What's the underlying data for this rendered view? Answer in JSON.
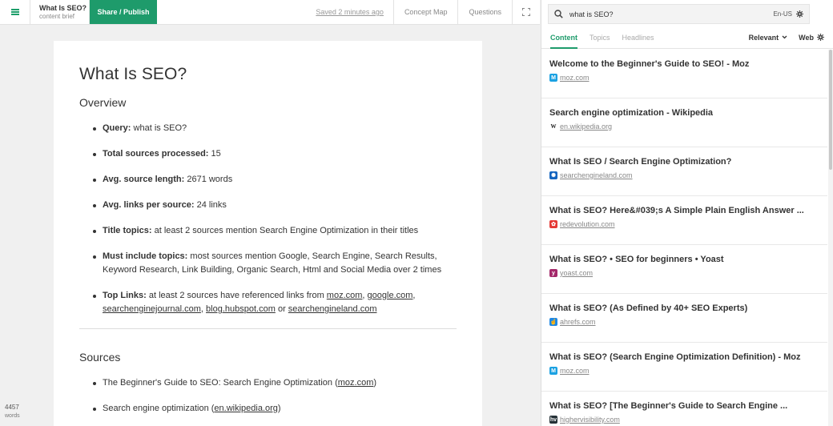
{
  "topbar": {
    "doc_title": "What Is SEO?",
    "doc_subtitle": "content brief",
    "share_label": "Share / Publish",
    "saved_label": "Saved 2 minutes ago",
    "nav": [
      "Concept Map",
      "Questions"
    ]
  },
  "doc": {
    "title": "What Is SEO?",
    "overview_heading": "Overview",
    "items": [
      {
        "label": "Query:",
        "text": " what is SEO?"
      },
      {
        "label": "Total sources processed:",
        "text": " 15"
      },
      {
        "label": "Avg. source length:",
        "text": " 2671 words"
      },
      {
        "label": "Avg. links per source:",
        "text": " 24 links"
      },
      {
        "label": "Title topics:",
        "text": " at least 2 sources mention Search Engine Optimization in their titles"
      },
      {
        "label": "Must include topics:",
        "text": " most sources mention Google, Search Engine, Search Results, Keyword Research, Link Building, Organic Search, Html and Social Media over 2 times"
      }
    ],
    "top_links": {
      "label": "Top Links:",
      "text": " at least 2 sources have referenced links from ",
      "links": [
        "moz.com",
        "google.com",
        "searchenginejournal.com",
        "blog.hubspot.com",
        "searchengineland.com"
      ],
      "or": " or "
    },
    "sources_heading": "Sources",
    "sources": [
      {
        "text": "The Beginner's Guide to SEO: Search Engine Optimization (",
        "link": "moz.com",
        "close": ")"
      },
      {
        "text": "Search engine optimization (",
        "link": "en.wikipedia.org",
        "close": ")"
      }
    ]
  },
  "wordcount": {
    "value": "4457",
    "label": "words"
  },
  "panel": {
    "search_value": "what is SEO?",
    "locale": "En-US",
    "tabs": [
      "Content",
      "Topics",
      "Headlines"
    ],
    "active_tab": "Content",
    "sort": "Relevant",
    "source": "Web",
    "results": [
      {
        "title": "Welcome to the Beginner's Guide to SEO! - Moz",
        "domain": "moz.com",
        "icon": "moz-favicon",
        "color": "#1ba1e2",
        "glyph": "M"
      },
      {
        "title": "Search engine optimization - Wikipedia",
        "domain": "en.wikipedia.org",
        "icon": "wikipedia-favicon",
        "color": "#ffffff",
        "glyph": "W"
      },
      {
        "title": "What Is SEO / Search Engine Optimization?",
        "domain": "searchengineland.com",
        "icon": "searchengineland-favicon",
        "color": "#1565c0",
        "glyph": "✺"
      },
      {
        "title": "What is SEO? Here&#039;s A Simple Plain English Answer ...",
        "domain": "redevolution.com",
        "icon": "redevolution-favicon",
        "color": "#e53935",
        "glyph": "✿"
      },
      {
        "title": "What is SEO? • SEO for beginners • Yoast",
        "domain": "yoast.com",
        "icon": "yoast-favicon",
        "color": "#a4286a",
        "glyph": "y"
      },
      {
        "title": "What is SEO? (As Defined by 40+ SEO Experts)",
        "domain": "ahrefs.com",
        "icon": "ahrefs-favicon",
        "color": "#1e88e5",
        "glyph": "☝"
      },
      {
        "title": "What is SEO? (Search Engine Optimization Definition) - Moz",
        "domain": "moz.com",
        "icon": "moz-favicon",
        "color": "#1ba1e2",
        "glyph": "M"
      },
      {
        "title": "What is SEO? [The Beginner's Guide to Search Engine ...",
        "domain": "highervisibility.com",
        "icon": "highervisibility-favicon",
        "color": "#263238",
        "glyph": "hv"
      }
    ]
  },
  "colors": {
    "accent": "#1e9b6b"
  }
}
